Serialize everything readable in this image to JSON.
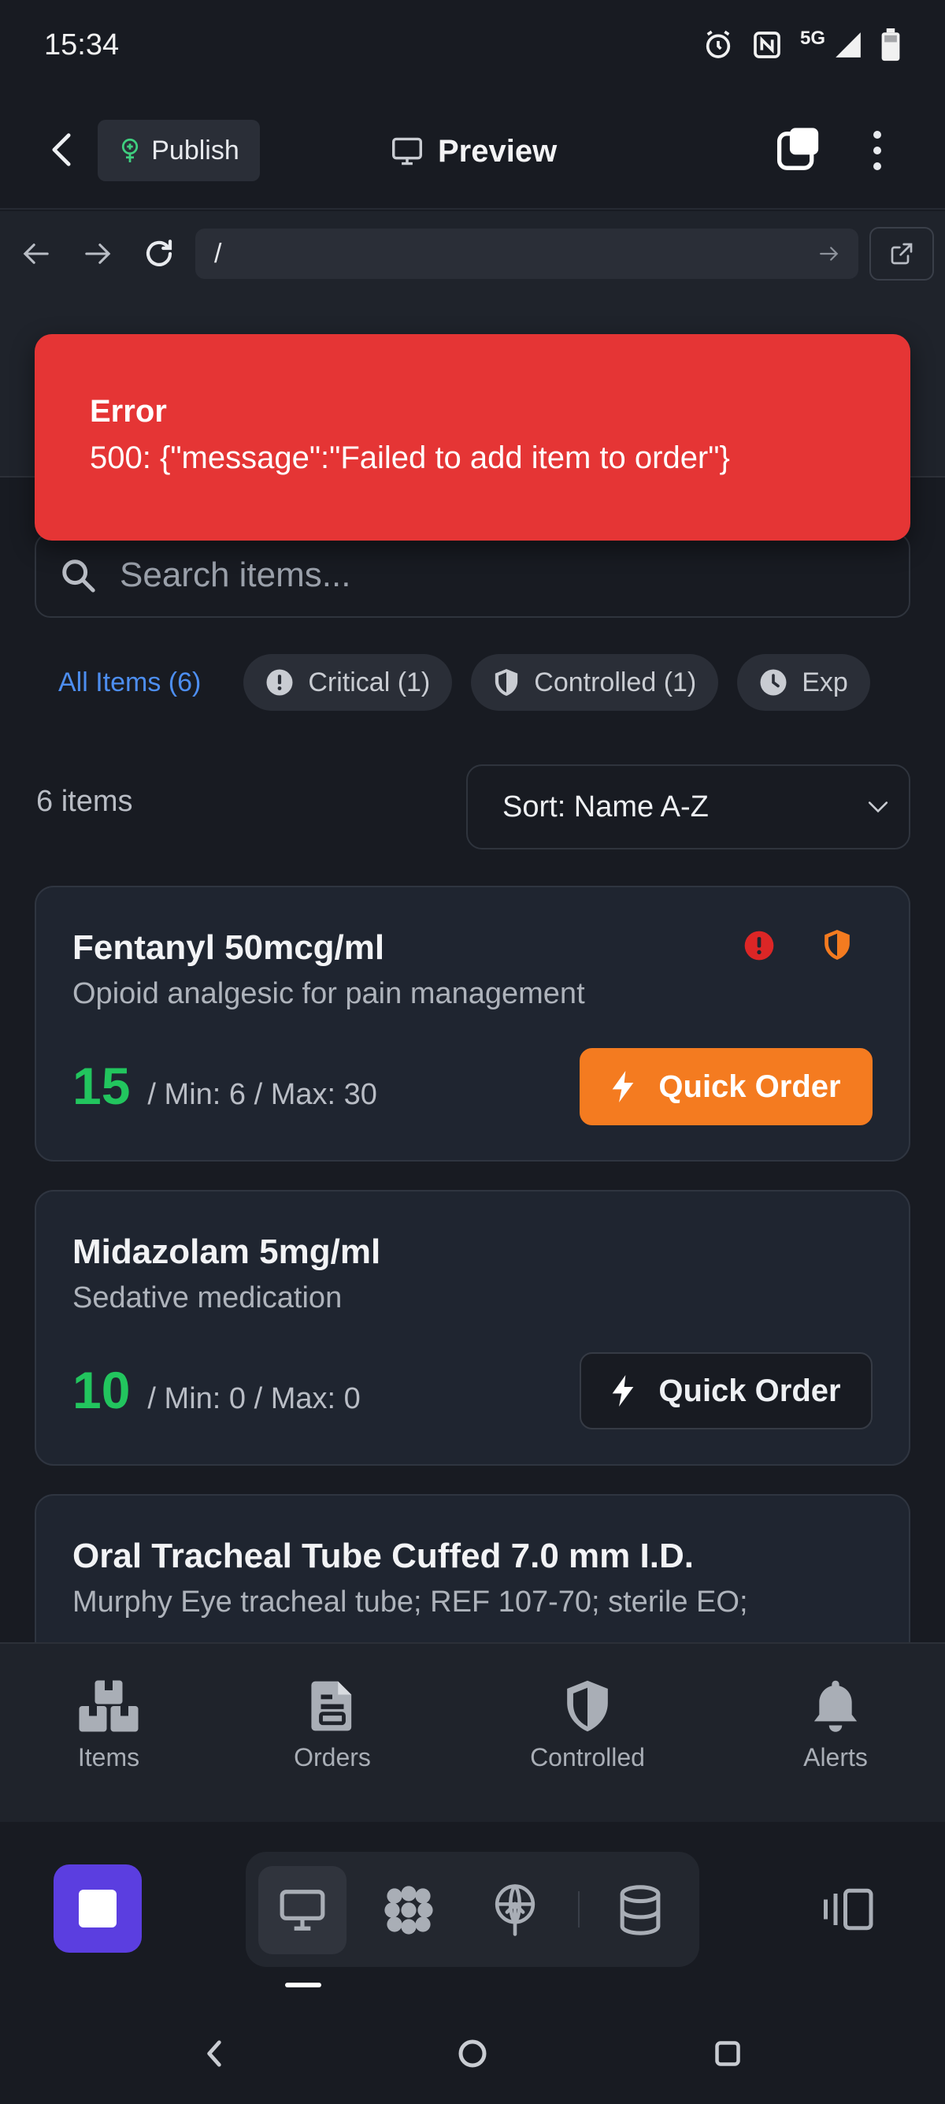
{
  "status_bar": {
    "time": "15:34",
    "network": "5G"
  },
  "header": {
    "publish_label": "Publish",
    "preview_label": "Preview"
  },
  "browser": {
    "url": "/"
  },
  "toast": {
    "title": "Error",
    "message": "500: {\"message\":\"Failed to add item to order\"}"
  },
  "search": {
    "placeholder": "Search items..."
  },
  "filters": [
    {
      "label": "All Items (6)",
      "icon": "none",
      "active": true
    },
    {
      "label": "Critical (1)",
      "icon": "alert-circle-icon",
      "active": false
    },
    {
      "label": "Controlled (1)",
      "icon": "shield-icon",
      "active": false
    },
    {
      "label": "Exp",
      "icon": "clock-icon",
      "active": false
    }
  ],
  "list": {
    "count_label": "6 items",
    "sort_label": "Sort: Name A-Z"
  },
  "items": [
    {
      "name": "Fentanyl 50mcg/ml",
      "description": "Opioid analgesic for pain management",
      "stock": "15",
      "range": "/ Min: 6 / Max: 30",
      "button": "Quick Order",
      "badges": [
        "critical-icon",
        "controlled-shield-icon"
      ]
    },
    {
      "name": "Midazolam 5mg/ml",
      "description": "Sedative medication",
      "stock": "10",
      "range": "/ Min: 0 / Max: 0",
      "button": "Quick Order",
      "badges": []
    },
    {
      "name": "Oral Tracheal Tube Cuffed 7.0 mm I.D.",
      "description": "Murphy Eye tracheal tube; REF 107-70; sterile EO;",
      "stock": "",
      "range": "",
      "button": "",
      "badges": []
    }
  ],
  "tabbar": [
    {
      "label": "Items",
      "icon": "boxes-icon"
    },
    {
      "label": "Orders",
      "icon": "document-icon"
    },
    {
      "label": "Controlled",
      "icon": "shield-icon"
    },
    {
      "label": "Alerts",
      "icon": "bell-icon"
    }
  ],
  "colors": {
    "background": "#181b22",
    "error": "#e53535",
    "accent_orange": "#f47b20",
    "stock_green": "#22c55e",
    "link_blue": "#4d8ef0",
    "stop_purple": "#5b3ee0"
  }
}
